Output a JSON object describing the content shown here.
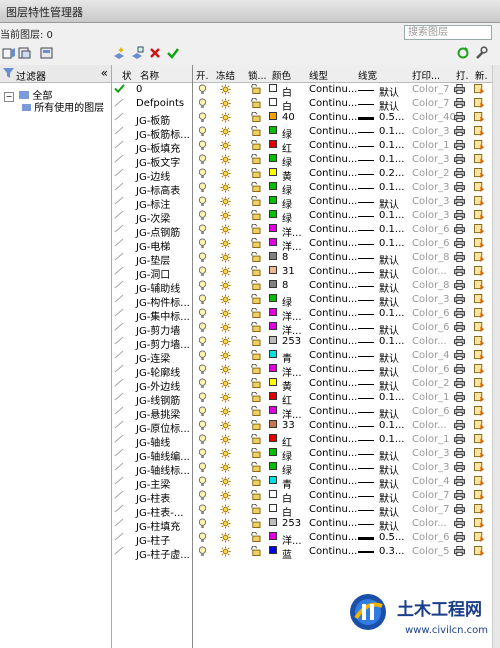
{
  "window": {
    "title": "图层特性管理器"
  },
  "current_layer": "当前图层: 0",
  "search": {
    "placeholder": "搜索图层"
  },
  "filter_panel": {
    "title": "过滤器",
    "tree": [
      "全部",
      "所有使用的图层"
    ]
  },
  "columns": {
    "status": "状",
    "name": "名称",
    "on": "开.",
    "freeze": "冻结",
    "lock": "锁...",
    "color": "颜色",
    "linetype": "线型",
    "lineweight": "线宽",
    "plotstyle": "打印...",
    "plot": "打.",
    "newvp": "新."
  },
  "layers": [
    {
      "name": "0",
      "color": "白",
      "hex": "#ffffff",
      "lt": "Continu...",
      "lw": "默认",
      "thick": 1,
      "ps": "Color_7"
    },
    {
      "name": "Defpoints",
      "color": "白",
      "hex": "#ffffff",
      "lt": "Continu...",
      "lw": "默认",
      "thick": 1,
      "ps": "Color_7"
    },
    {
      "name": "JG-板筋",
      "color": "40",
      "hex": "#f5a000",
      "lt": "Continu...",
      "lw": "0.5...",
      "thick": 3,
      "ps": "Color_40"
    },
    {
      "name": "JG-板筋标...",
      "color": "绿",
      "hex": "#00c000",
      "lt": "Continu...",
      "lw": "0.1...",
      "thick": 1,
      "ps": "Color_3"
    },
    {
      "name": "JG-板填充",
      "color": "红",
      "hex": "#e00000",
      "lt": "Continu...",
      "lw": "0.1...",
      "thick": 1,
      "ps": "Color_1"
    },
    {
      "name": "JG-板文字",
      "color": "绿",
      "hex": "#00c000",
      "lt": "Continu...",
      "lw": "0.1...",
      "thick": 1,
      "ps": "Color_3"
    },
    {
      "name": "JG-边线",
      "color": "黄",
      "hex": "#ffff00",
      "lt": "Continu...",
      "lw": "0.2...",
      "thick": 1,
      "ps": "Color_2"
    },
    {
      "name": "JG-标高表",
      "color": "绿",
      "hex": "#00c000",
      "lt": "Continu...",
      "lw": "0.1...",
      "thick": 1,
      "ps": "Color_3"
    },
    {
      "name": "JG-标注",
      "color": "绿",
      "hex": "#00c000",
      "lt": "Continu...",
      "lw": "默认",
      "thick": 1,
      "ps": "Color_3"
    },
    {
      "name": "JG-次梁",
      "color": "绿",
      "hex": "#00c000",
      "lt": "Continu...",
      "lw": "0.1...",
      "thick": 1,
      "ps": "Color_3"
    },
    {
      "name": "JG-点钢筋",
      "color": "洋...",
      "hex": "#e000e0",
      "lt": "Continu...",
      "lw": "0.1...",
      "thick": 1,
      "ps": "Color_6"
    },
    {
      "name": "JG-电梯",
      "color": "洋...",
      "hex": "#e000e0",
      "lt": "Continu...",
      "lw": "0.1...",
      "thick": 1,
      "ps": "Color_6"
    },
    {
      "name": "JG-垫层",
      "color": "8",
      "hex": "#808080",
      "lt": "Continu...",
      "lw": "默认",
      "thick": 1,
      "ps": "Color_8"
    },
    {
      "name": "JG-洞口",
      "color": "31",
      "hex": "#f0b890",
      "lt": "Continu...",
      "lw": "默认",
      "thick": 1,
      "ps": "Color..."
    },
    {
      "name": "JG-辅助线",
      "color": "8",
      "hex": "#808080",
      "lt": "Continu...",
      "lw": "默认",
      "thick": 1,
      "ps": "Color_8"
    },
    {
      "name": "JG-构件标...",
      "color": "绿",
      "hex": "#00c000",
      "lt": "Continu...",
      "lw": "默认",
      "thick": 1,
      "ps": "Color_3"
    },
    {
      "name": "JG-集中标...",
      "color": "洋...",
      "hex": "#e000e0",
      "lt": "Continu...",
      "lw": "0.1...",
      "thick": 1,
      "ps": "Color_6"
    },
    {
      "name": "JG-剪力墙",
      "color": "洋...",
      "hex": "#e000e0",
      "lt": "Continu...",
      "lw": "默认",
      "thick": 1,
      "ps": "Color_6"
    },
    {
      "name": "JG-剪力墙...",
      "color": "253",
      "hex": "#bdbdbd",
      "lt": "Continu...",
      "lw": "0.1...",
      "thick": 1,
      "ps": "Color..."
    },
    {
      "name": "JG-连梁",
      "color": "青",
      "hex": "#00e0e0",
      "lt": "Continu...",
      "lw": "默认",
      "thick": 1,
      "ps": "Color_4"
    },
    {
      "name": "JG-轮廓线",
      "color": "洋...",
      "hex": "#e000e0",
      "lt": "Continu...",
      "lw": "默认",
      "thick": 1,
      "ps": "Color_6"
    },
    {
      "name": "JG-外边线",
      "color": "黄",
      "hex": "#ffff00",
      "lt": "Continu...",
      "lw": "默认",
      "thick": 1,
      "ps": "Color_2"
    },
    {
      "name": "JG-线钢筋",
      "color": "红",
      "hex": "#e00000",
      "lt": "Continu...",
      "lw": "0.1...",
      "thick": 1,
      "ps": "Color_1"
    },
    {
      "name": "JG-悬挑梁",
      "color": "洋...",
      "hex": "#e000e0",
      "lt": "Continu...",
      "lw": "默认",
      "thick": 1,
      "ps": "Color_6"
    },
    {
      "name": "JG-原位标...",
      "color": "33",
      "hex": "#c87850",
      "lt": "Continu...",
      "lw": "0.1...",
      "thick": 1,
      "ps": "Color..."
    },
    {
      "name": "JG-轴线",
      "color": "红",
      "hex": "#e00000",
      "lt": "Continu...",
      "lw": "0.1...",
      "thick": 1,
      "ps": "Color_1"
    },
    {
      "name": "JG-轴线编...",
      "color": "绿",
      "hex": "#00c000",
      "lt": "Continu...",
      "lw": "默认",
      "thick": 1,
      "ps": "Color_3"
    },
    {
      "name": "JG-轴线标...",
      "color": "绿",
      "hex": "#00c000",
      "lt": "Continu...",
      "lw": "默认",
      "thick": 1,
      "ps": "Color_3"
    },
    {
      "name": "JG-主梁",
      "color": "青",
      "hex": "#00e0e0",
      "lt": "Continu...",
      "lw": "默认",
      "thick": 1,
      "ps": "Color_4"
    },
    {
      "name": "JG-柱表",
      "color": "白",
      "hex": "#ffffff",
      "lt": "Continu...",
      "lw": "默认",
      "thick": 1,
      "ps": "Color_7"
    },
    {
      "name": "JG-柱表-...",
      "color": "白",
      "hex": "#ffffff",
      "lt": "Continu...",
      "lw": "默认",
      "thick": 1,
      "ps": "Color_7"
    },
    {
      "name": "JG-柱填充",
      "color": "253",
      "hex": "#bdbdbd",
      "lt": "Continu...",
      "lw": "默认",
      "thick": 1,
      "ps": "Color..."
    },
    {
      "name": "JG-柱子",
      "color": "洋...",
      "hex": "#e000e0",
      "lt": "Continu...",
      "lw": "0.5...",
      "thick": 3,
      "ps": "Color_6"
    },
    {
      "name": "JG-柱子虚...",
      "color": "蓝",
      "hex": "#0000e0",
      "lt": "Continu...",
      "lw": "0.3...",
      "thick": 2,
      "ps": "Color_5"
    }
  ],
  "watermark": {
    "brand": "土木工程网",
    "url": "www.civilcn.com"
  }
}
